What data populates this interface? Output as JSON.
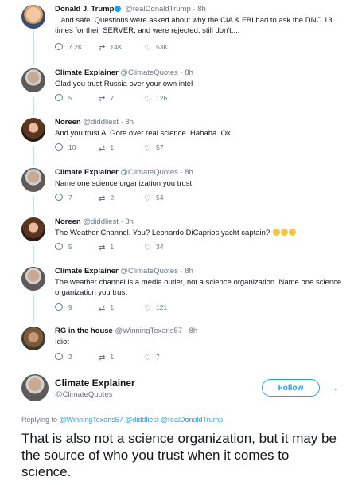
{
  "tweets": [
    {
      "name": "Donald J. Trump",
      "verified": true,
      "handle": "@realDonaldTrump",
      "time": "· 8h",
      "text": "...and safe. Questions were asked about why the CIA & FBI had to ask the DNC 13 times for their SERVER, and were rejected, still don't....",
      "replies": "7.2K",
      "retweets": "14K",
      "likes": "53K"
    },
    {
      "name": "Climate Explainer",
      "handle": "@ClimateQuotes",
      "time": "· 8h",
      "text": "Glad you trust Russia over your own intel",
      "replies": "5",
      "retweets": "7",
      "likes": "126"
    },
    {
      "name": "Noreen",
      "handle": "@diddliest",
      "time": "· 8h",
      "text": "And you trust Al Gore over real science. Hahaha. Ok",
      "replies": "10",
      "retweets": "1",
      "likes": "57"
    },
    {
      "name": "Climate Explainer",
      "handle": "@ClimateQuotes",
      "time": "· 8h",
      "text": "Name one science organization you trust",
      "replies": "7",
      "retweets": "2",
      "likes": "54"
    },
    {
      "name": "Noreen",
      "handle": "@diddliest",
      "time": "· 8h",
      "text": "The Weather Channel. You? Leonardo DiCaprios yacht captain?",
      "replies": "5",
      "retweets": "1",
      "likes": "34"
    },
    {
      "name": "Climate Explainer",
      "handle": "@ClimateQuotes",
      "time": "· 8h",
      "text": "The weather channel is a media outlet, not a science organization. Name one science organization you trust",
      "replies": "9",
      "retweets": "1",
      "likes": "121"
    },
    {
      "name": "RG in the house",
      "handle": "@WinningTexans57",
      "time": "· 8h",
      "text": "Idiot",
      "replies": "2",
      "retweets": "1",
      "likes": "7"
    }
  ],
  "main": {
    "name": "Climate Explainer",
    "handle": "@ClimateQuotes",
    "follow_label": "Follow",
    "replying_prefix": "Replying to",
    "replying_to": "@WinningTexans57 @diddliest @realDonaldTrump",
    "text": "That is also not a science organization, but it may be the source of who you trust when it comes to science."
  },
  "icons": {
    "reply": "reply-icon",
    "retweet": "retweet-icon",
    "like": "heart-icon",
    "menu": "chevron-down-icon"
  },
  "colors": {
    "link": "#1da1f2",
    "muted": "#657786",
    "thread_line": "#c6e0f5"
  }
}
